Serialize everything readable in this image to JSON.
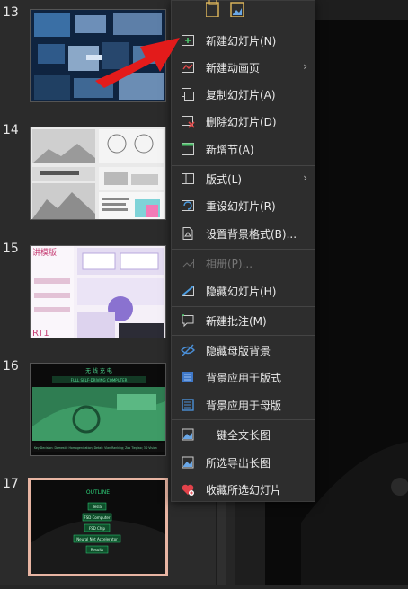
{
  "slides": [
    {
      "number": "13"
    },
    {
      "number": "14"
    },
    {
      "number": "15"
    },
    {
      "number": "16"
    },
    {
      "number": "17"
    }
  ],
  "menu": {
    "items": [
      {
        "label": "新建幻灯片(N)",
        "icon": "new-slide-icon"
      },
      {
        "label": "新建动画页",
        "icon": "new-animation-page-icon"
      },
      {
        "label": "复制幻灯片(A)",
        "icon": "copy-slide-icon"
      },
      {
        "label": "删除幻灯片(D)",
        "icon": "delete-slide-icon"
      },
      {
        "label": "新增节(A)",
        "icon": "new-section-icon"
      },
      {
        "label": "版式(L)",
        "icon": "layout-icon"
      },
      {
        "label": "重设幻灯片(R)",
        "icon": "reset-slide-icon"
      },
      {
        "label": "设置背景格式(B)...",
        "icon": "background-format-icon"
      },
      {
        "label": "相册(P)...",
        "icon": "photo-album-icon"
      },
      {
        "label": "隐藏幻灯片(H)",
        "icon": "hide-slide-icon"
      },
      {
        "label": "新建批注(M)",
        "icon": "new-comment-icon"
      },
      {
        "label": "隐藏母版背景",
        "icon": "hide-master-background-icon"
      },
      {
        "label": "背景应用于版式",
        "icon": "apply-background-layout-icon"
      },
      {
        "label": "背景应用于母版",
        "icon": "apply-background-master-icon"
      },
      {
        "label": "一键全文长图",
        "icon": "long-image-all-icon"
      },
      {
        "label": "所选导出长图",
        "icon": "export-selected-long-image-icon"
      },
      {
        "label": "收藏所选幻灯片",
        "icon": "favorite-slides-icon"
      }
    ]
  },
  "thumb16": {
    "title": "无 线 充 电",
    "subtitle": "FULL SELF-DRIVING COMPUTER",
    "footer": "Key Decision: Domestic Homogenization; Detail: Vlan Ranking; Zoo Tiegiao; 3D Vision"
  },
  "thumb17": {
    "title": "OUTLINE",
    "items": [
      "Tesla",
      "FSD Computer",
      "FSD Chip",
      "Neural Net Accelerator",
      "Results"
    ]
  },
  "thumb15": {
    "title_fragment": "讲模版",
    "corner": "RT1"
  },
  "colors": {
    "accent_arrow": "#e31b1b",
    "selected_border": "#e8b5a3",
    "menu_bg": "#2d2d2d"
  }
}
